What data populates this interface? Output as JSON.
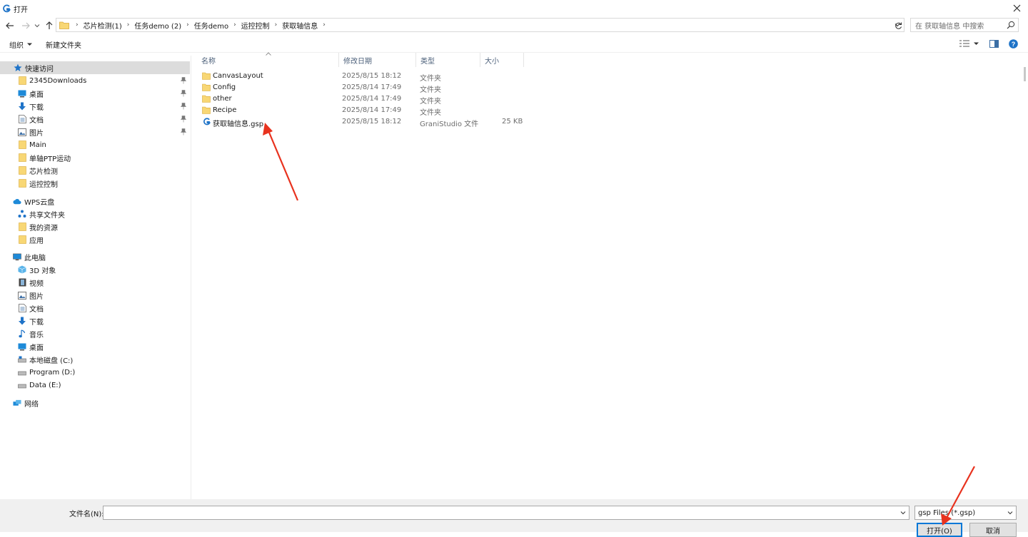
{
  "window": {
    "title": "打开"
  },
  "address": {
    "crumbs": [
      "芯片检测(1)",
      "任务demo (2)",
      "任务demo",
      "运控控制",
      "获取轴信息"
    ]
  },
  "search": {
    "placeholder": "在 获取轴信息 中搜索"
  },
  "toolbar": {
    "organize": "组织",
    "new_folder": "新建文件夹"
  },
  "nav": {
    "quick_access": "快速访问",
    "quick_items": [
      "2345Downloads",
      "桌面",
      "下载",
      "文档",
      "图片",
      "Main",
      "单轴PTP运动",
      "芯片检测",
      "运控控制"
    ],
    "wps": "WPS云盘",
    "wps_items": [
      "共享文件夹",
      "我的资源",
      "应用"
    ],
    "pc": "此电脑",
    "pc_items": [
      "3D 对象",
      "视频",
      "图片",
      "文档",
      "下载",
      "音乐",
      "桌面",
      "本地磁盘 (C:)",
      "Program (D:)",
      "Data (E:)"
    ],
    "network": "网络"
  },
  "columns": {
    "name": "名称",
    "date": "修改日期",
    "type": "类型",
    "size": "大小"
  },
  "files": [
    {
      "name": "CanvasLayout",
      "date": "2025/8/15 18:12",
      "type": "文件夹",
      "size": ""
    },
    {
      "name": "Config",
      "date": "2025/8/14 17:49",
      "type": "文件夹",
      "size": ""
    },
    {
      "name": "other",
      "date": "2025/8/14 17:49",
      "type": "文件夹",
      "size": ""
    },
    {
      "name": "Recipe",
      "date": "2025/8/14 17:49",
      "type": "文件夹",
      "size": ""
    },
    {
      "name": "获取轴信息.gsp",
      "date": "2025/8/15 18:12",
      "type": "GraniStudio 文件",
      "size": "25 KB"
    }
  ],
  "bottom": {
    "filename_label": "文件名(N):",
    "filename_value": "",
    "filetype": "gsp Files (*.gsp)",
    "open_button": "打开(O)",
    "cancel_button": "取消"
  },
  "colors": {
    "accent": "#0078d7",
    "folder": "#f8d775",
    "annotation_arrow": "#e8321e"
  }
}
